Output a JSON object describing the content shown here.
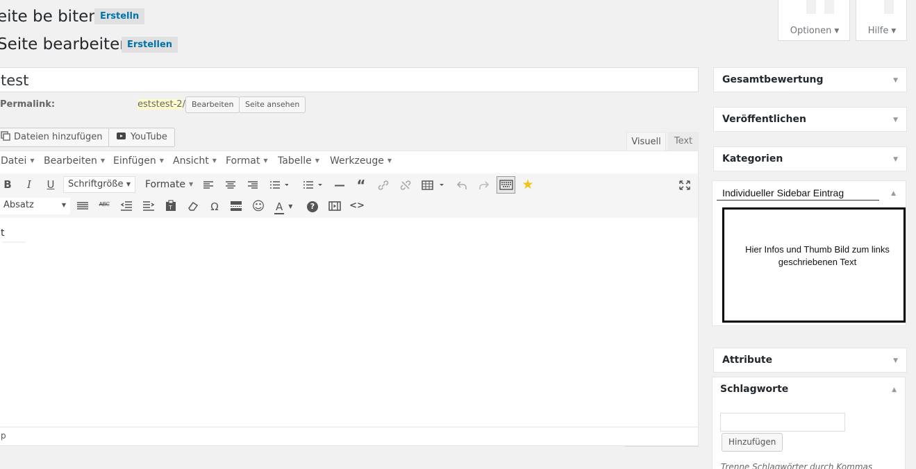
{
  "header": {
    "line1_title": "eite be biten",
    "line1_button": "Erstelln",
    "line2_title": "Seite bearbeiten",
    "line2_button": "Erstellen"
  },
  "screen_options": {
    "label": "Optionen",
    "arrow": "▼"
  },
  "help": {
    "label": "Hilfe",
    "arrow": "▼"
  },
  "title_field": {
    "value": "test"
  },
  "permalink": {
    "label": "Permalink:",
    "slug": "eststest-2",
    "suffix": "/",
    "edit_button": "Bearbeiten",
    "view_button": "Seite ansehen"
  },
  "media": {
    "add_files": "Dateien hinzufügen",
    "youtube": "YouTube"
  },
  "editor_tabs": {
    "visual": "Visuell",
    "text": "Text"
  },
  "menubar": [
    "Datei",
    "Bearbeiten",
    "Einfügen",
    "Ansicht",
    "Format",
    "Tabelle",
    "Werkzeuge"
  ],
  "toolbar": {
    "font_size": "Schriftgröße",
    "formats": "Formate",
    "paragraph": "Absatz",
    "bold": "B",
    "italic": "I",
    "underline": "U",
    "strike": "ABC",
    "omega": "Ω",
    "text_color": "A",
    "help": "?",
    "code": "<>"
  },
  "content": {
    "text": "t",
    "path": "p"
  },
  "sidebar": {
    "rating": "Gesamtbewertung",
    "publish": "Veröffentlichen",
    "categories": "Kategorien",
    "custom": {
      "title": "Individueller Sidebar Eintrag",
      "text": "Hier Infos und Thumb Bild zum links geschriebenen Text"
    },
    "attributes": "Attribute",
    "tags": {
      "title": "Schlagworte",
      "add_button": "Hinzufügen",
      "hint": "Trenne Schlagwörter durch Kommas"
    },
    "arrow_down": "▼",
    "arrow_up": "▲"
  }
}
